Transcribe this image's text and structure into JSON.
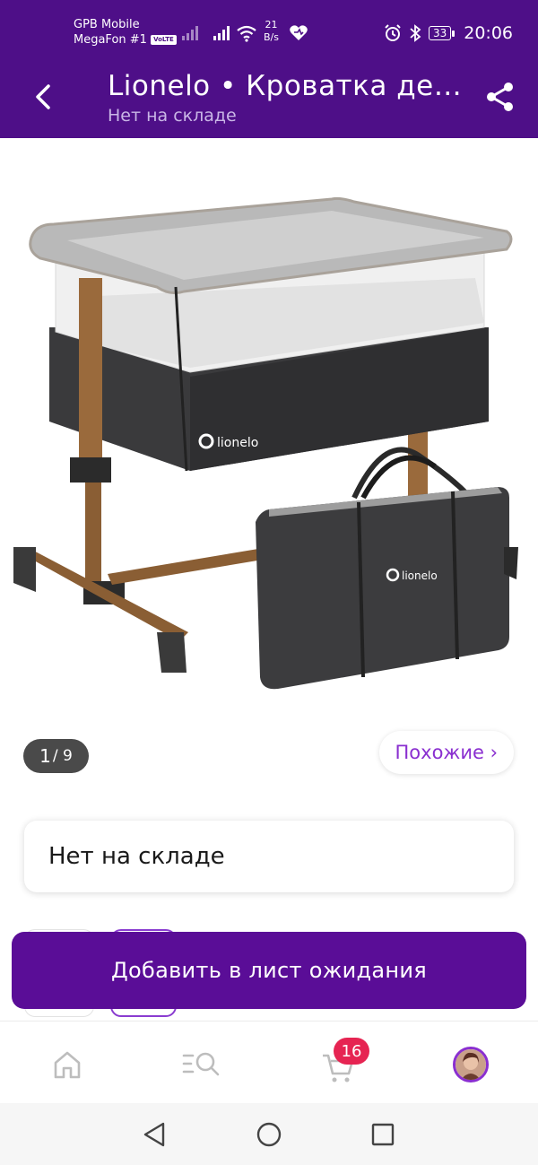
{
  "status_bar": {
    "carrier_line1": "GPB Mobile",
    "carrier_line2": "MegaFon #1",
    "volte": "VoLTE",
    "speed_value": "21",
    "speed_unit": "B/s",
    "battery": "33",
    "time": "20:06"
  },
  "header": {
    "title": "Lionelo  •  Кроватка детская приставная",
    "subtitle": "Нет на складе"
  },
  "gallery": {
    "current": "1",
    "total": "/ 9",
    "brand_on_bed": "lionelo",
    "brand_on_bag": "lionelo"
  },
  "similar_button": "Похожие ›",
  "stock_status": "Нет на складе",
  "cta": {
    "label": "Добавить в лист ожидания"
  },
  "bottom_nav": {
    "items": [
      "home-icon",
      "catalog-search-icon",
      "cart-icon",
      "profile-avatar"
    ],
    "cart_badge": "16"
  },
  "system_nav": [
    "back-triangle",
    "home-circle",
    "recents-square"
  ],
  "colors": {
    "brand_purple": "#4e0f88",
    "button_purple": "#5a0d97",
    "accent": "#8a2fd0",
    "badge": "#e62452"
  }
}
